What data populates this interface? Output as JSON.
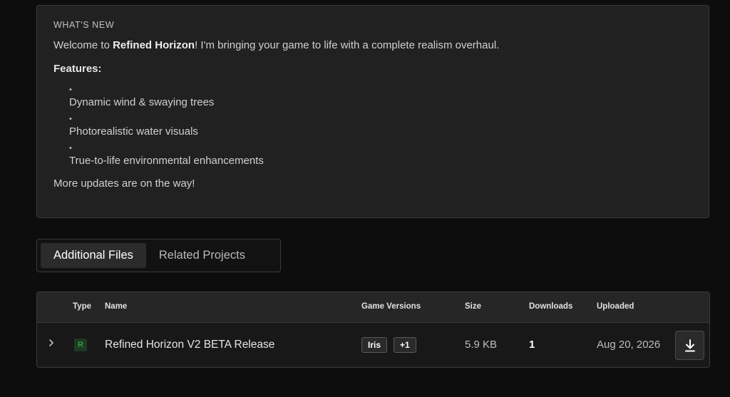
{
  "whats_new": {
    "heading": "WHAT'S NEW",
    "intro_prefix": "Welcome to ",
    "intro_strong": "Refined Horizon",
    "intro_suffix": "! I'm bringing your game to life with a complete realism overhaul.",
    "features_label": "Features:",
    "bullet": "•",
    "features": [
      "Dynamic wind & swaying trees",
      "Photorealistic water visuals",
      "True-to-life environmental enhancements"
    ],
    "outro": "More updates are on the way!"
  },
  "tabs": [
    {
      "label": "Additional Files",
      "active": true
    },
    {
      "label": "Related Projects",
      "active": false
    }
  ],
  "files_table": {
    "headers": {
      "type": "Type",
      "name": "Name",
      "game_versions": "Game Versions",
      "size": "Size",
      "downloads": "Downloads",
      "uploaded": "Uploaded"
    },
    "rows": [
      {
        "expand_icon": "chevron-right-icon",
        "type_badge": "R",
        "name": "Refined Horizon V2 BETA Release",
        "versions": [
          "Iris",
          "+1"
        ],
        "size": "5.9 KB",
        "downloads": "1",
        "uploaded": "Aug 20, 2026",
        "action_icon": "download-icon"
      }
    ]
  },
  "colors": {
    "page_bg": "#0d0d0d",
    "panel_bg": "#212121",
    "border": "#3a3a3a",
    "release_badge": "#3fb950"
  }
}
